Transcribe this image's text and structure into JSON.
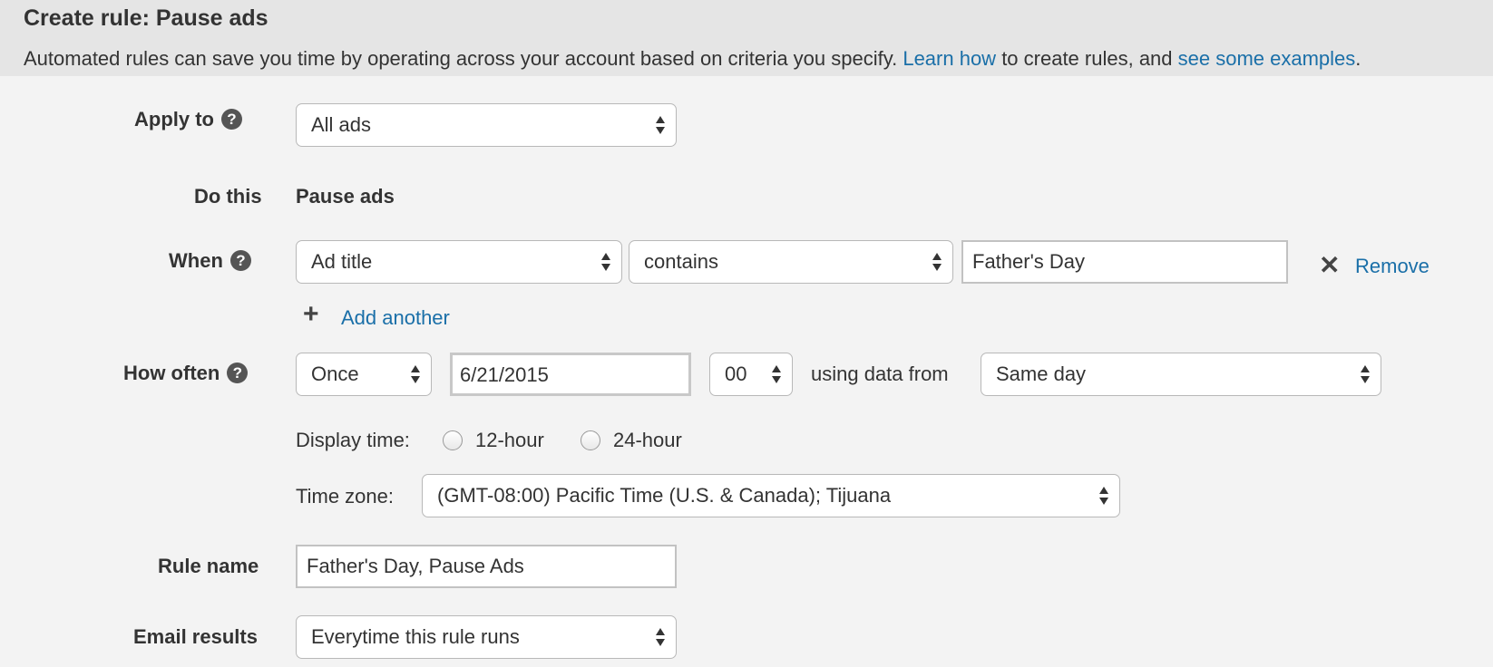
{
  "header": {
    "title": "Create rule: Pause ads",
    "description_before": "Automated rules can save you time by operating across your account based on criteria you specify. ",
    "learn_how_link": "Learn how",
    "description_middle": " to create rules, and ",
    "examples_link": "see some examples",
    "description_after": "."
  },
  "apply_to": {
    "label": "Apply to",
    "help_icon": "?",
    "value": "All ads"
  },
  "do_this": {
    "label": "Do this",
    "value": "Pause ads"
  },
  "when": {
    "label": "When",
    "help_icon": "?",
    "field": "Ad title",
    "operator": "contains",
    "value": "Father's Day",
    "remove_icon": "✕",
    "remove_label": "Remove",
    "add_icon": "+",
    "add_label": "Add another"
  },
  "how_often": {
    "label": "How often",
    "help_icon": "?",
    "frequency": "Once",
    "date": "6/21/2015",
    "hour": "00",
    "using_data_label": "using data from",
    "data_range": "Same day"
  },
  "display_time": {
    "label": "Display time:",
    "options": [
      "12-hour",
      "24-hour"
    ]
  },
  "time_zone": {
    "label": "Time zone:",
    "value": "(GMT-08:00) Pacific Time (U.S. & Canada); Tijuana"
  },
  "rule_name": {
    "label": "Rule name",
    "value": "Father's Day, Pause Ads"
  },
  "email_results": {
    "label": "Email results",
    "value": "Everytime this rule runs"
  }
}
